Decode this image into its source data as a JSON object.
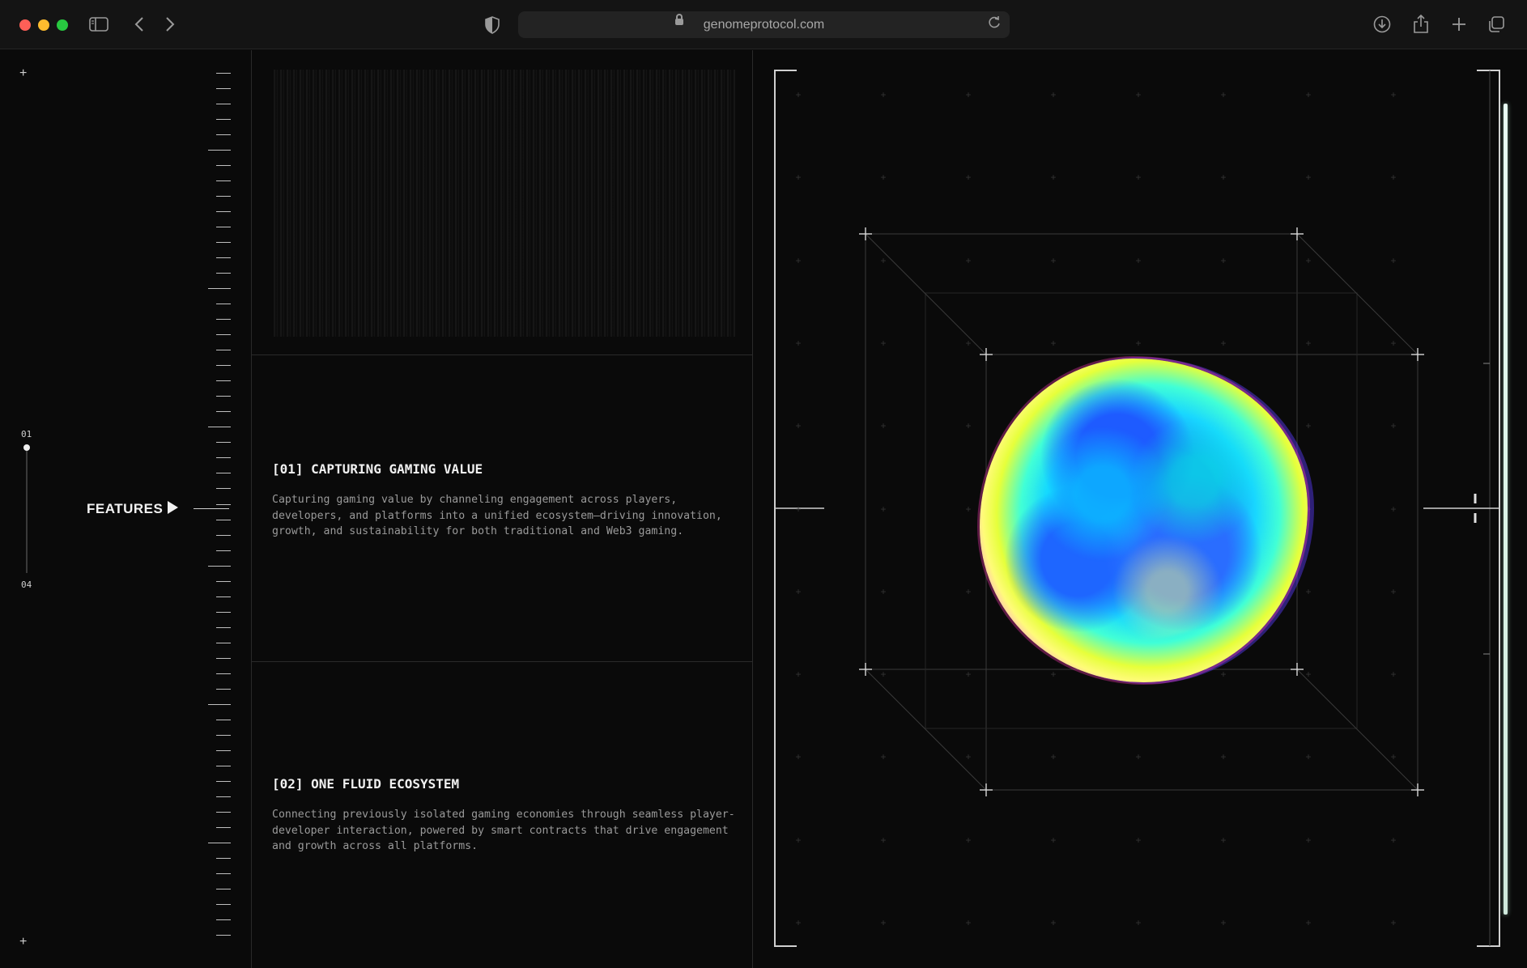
{
  "browser": {
    "url": "genomeprotocol.com",
    "icons": {
      "sidebar": "sidebar-icon",
      "back": "chevron-left-icon",
      "forward": "chevron-right-icon",
      "privacy": "shield-icon",
      "reload": "reload-icon",
      "download": "download-icon",
      "share": "share-icon",
      "new_tab": "plus-icon",
      "tabs": "tabs-overview-icon"
    },
    "traffic_colors": [
      "#ff5f57",
      "#febc2e",
      "#28c840"
    ]
  },
  "nav": {
    "counter_start": "01",
    "counter_end": "04",
    "section_label": "FEATURES",
    "progress": 0.0
  },
  "features": [
    {
      "title": "[01] CAPTURING GAMING VALUE",
      "description": "Capturing gaming value by channeling engagement across players, developers, and platforms into a unified ecosystem—driving innovation, growth, and sustainability for both traditional and Web3 gaming."
    },
    {
      "title": "[02] ONE FLUID ECOSYSTEM",
      "description": "Connecting previously isolated gaming economies through seamless player-developer interaction, powered by smart contracts that drive engagement and growth across all platforms."
    }
  ],
  "colors": {
    "background": "#0a0a0a",
    "accent_slider": "#e8fff3",
    "blob_primary": "#1e5bff",
    "blob_edge_pink": "#ff3ea8",
    "blob_edge_yellow": "#e6ff3a"
  }
}
